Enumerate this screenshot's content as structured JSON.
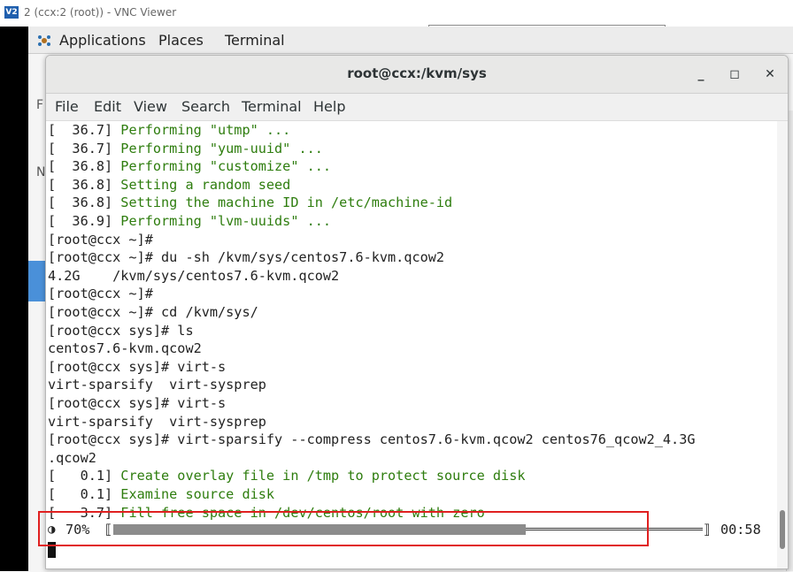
{
  "vnc": {
    "title": "2 (ccx:2 (root)) - VNC Viewer",
    "logo_text": "V2"
  },
  "panel": {
    "applications": "Applications",
    "places": "Places",
    "terminal": "Terminal"
  },
  "terminal": {
    "title": "root@ccx:/kvm/sys",
    "minimize_glyph": "_",
    "maximize_glyph": "◻",
    "close_glyph": "✕",
    "menu": [
      "File",
      "Edit",
      "View",
      "Search",
      "Terminal",
      "Help"
    ],
    "lines": [
      {
        "prefix": "[  36.7] ",
        "text": "Performing \"utmp\" ...",
        "green": true
      },
      {
        "prefix": "[  36.7] ",
        "text": "Performing \"yum-uuid\" ...",
        "green": true
      },
      {
        "prefix": "[  36.8] ",
        "text": "Performing \"customize\" ...",
        "green": true
      },
      {
        "prefix": "[  36.8] ",
        "text": "Setting a random seed",
        "green": true
      },
      {
        "prefix": "[  36.8] ",
        "text": "Setting the machine ID in /etc/machine-id",
        "green": true
      },
      {
        "prefix": "[  36.9] ",
        "text": "Performing \"lvm-uuids\" ...",
        "green": true
      },
      {
        "prefix": "",
        "text": "[root@ccx ~]#",
        "green": false
      },
      {
        "prefix": "",
        "text": "[root@ccx ~]# du -sh /kvm/sys/centos7.6-kvm.qcow2",
        "green": false
      },
      {
        "prefix": "",
        "text": "4.2G    /kvm/sys/centos7.6-kvm.qcow2",
        "green": false
      },
      {
        "prefix": "",
        "text": "[root@ccx ~]#",
        "green": false
      },
      {
        "prefix": "",
        "text": "[root@ccx ~]# cd /kvm/sys/",
        "green": false
      },
      {
        "prefix": "",
        "text": "[root@ccx sys]# ls",
        "green": false
      },
      {
        "prefix": "",
        "text": "centos7.6-kvm.qcow2",
        "green": false
      },
      {
        "prefix": "",
        "text": "[root@ccx sys]# virt-s",
        "green": false
      },
      {
        "prefix": "",
        "text": "virt-sparsify  virt-sysprep",
        "green": false
      },
      {
        "prefix": "",
        "text": "[root@ccx sys]# virt-s",
        "green": false
      },
      {
        "prefix": "",
        "text": "virt-sparsify  virt-sysprep",
        "green": false
      },
      {
        "prefix": "",
        "text": "[root@ccx sys]# virt-sparsify --compress centos7.6-kvm.qcow2 centos76_qcow2_4.3G",
        "green": false
      },
      {
        "prefix": "",
        "text": ".qcow2",
        "green": false
      },
      {
        "prefix": "[   0.1] ",
        "text": "Create overlay file in /tmp to protect source disk",
        "green": true
      },
      {
        "prefix": "[   0.1] ",
        "text": "Examine source disk",
        "green": true
      },
      {
        "prefix": "[   3.7] ",
        "text": "Fill free space in /dev/centos/root with zero",
        "green": true
      }
    ],
    "progress": {
      "spinner": "◑",
      "percent_text": "70%",
      "fraction": 0.7,
      "bracket_left": "⟦",
      "bracket_right": "⟧",
      "time": "00:58"
    }
  },
  "colors": {
    "green_text": "#2e7d0e",
    "highlight": "#e02020",
    "progress_fill": "#8c8c8c"
  }
}
